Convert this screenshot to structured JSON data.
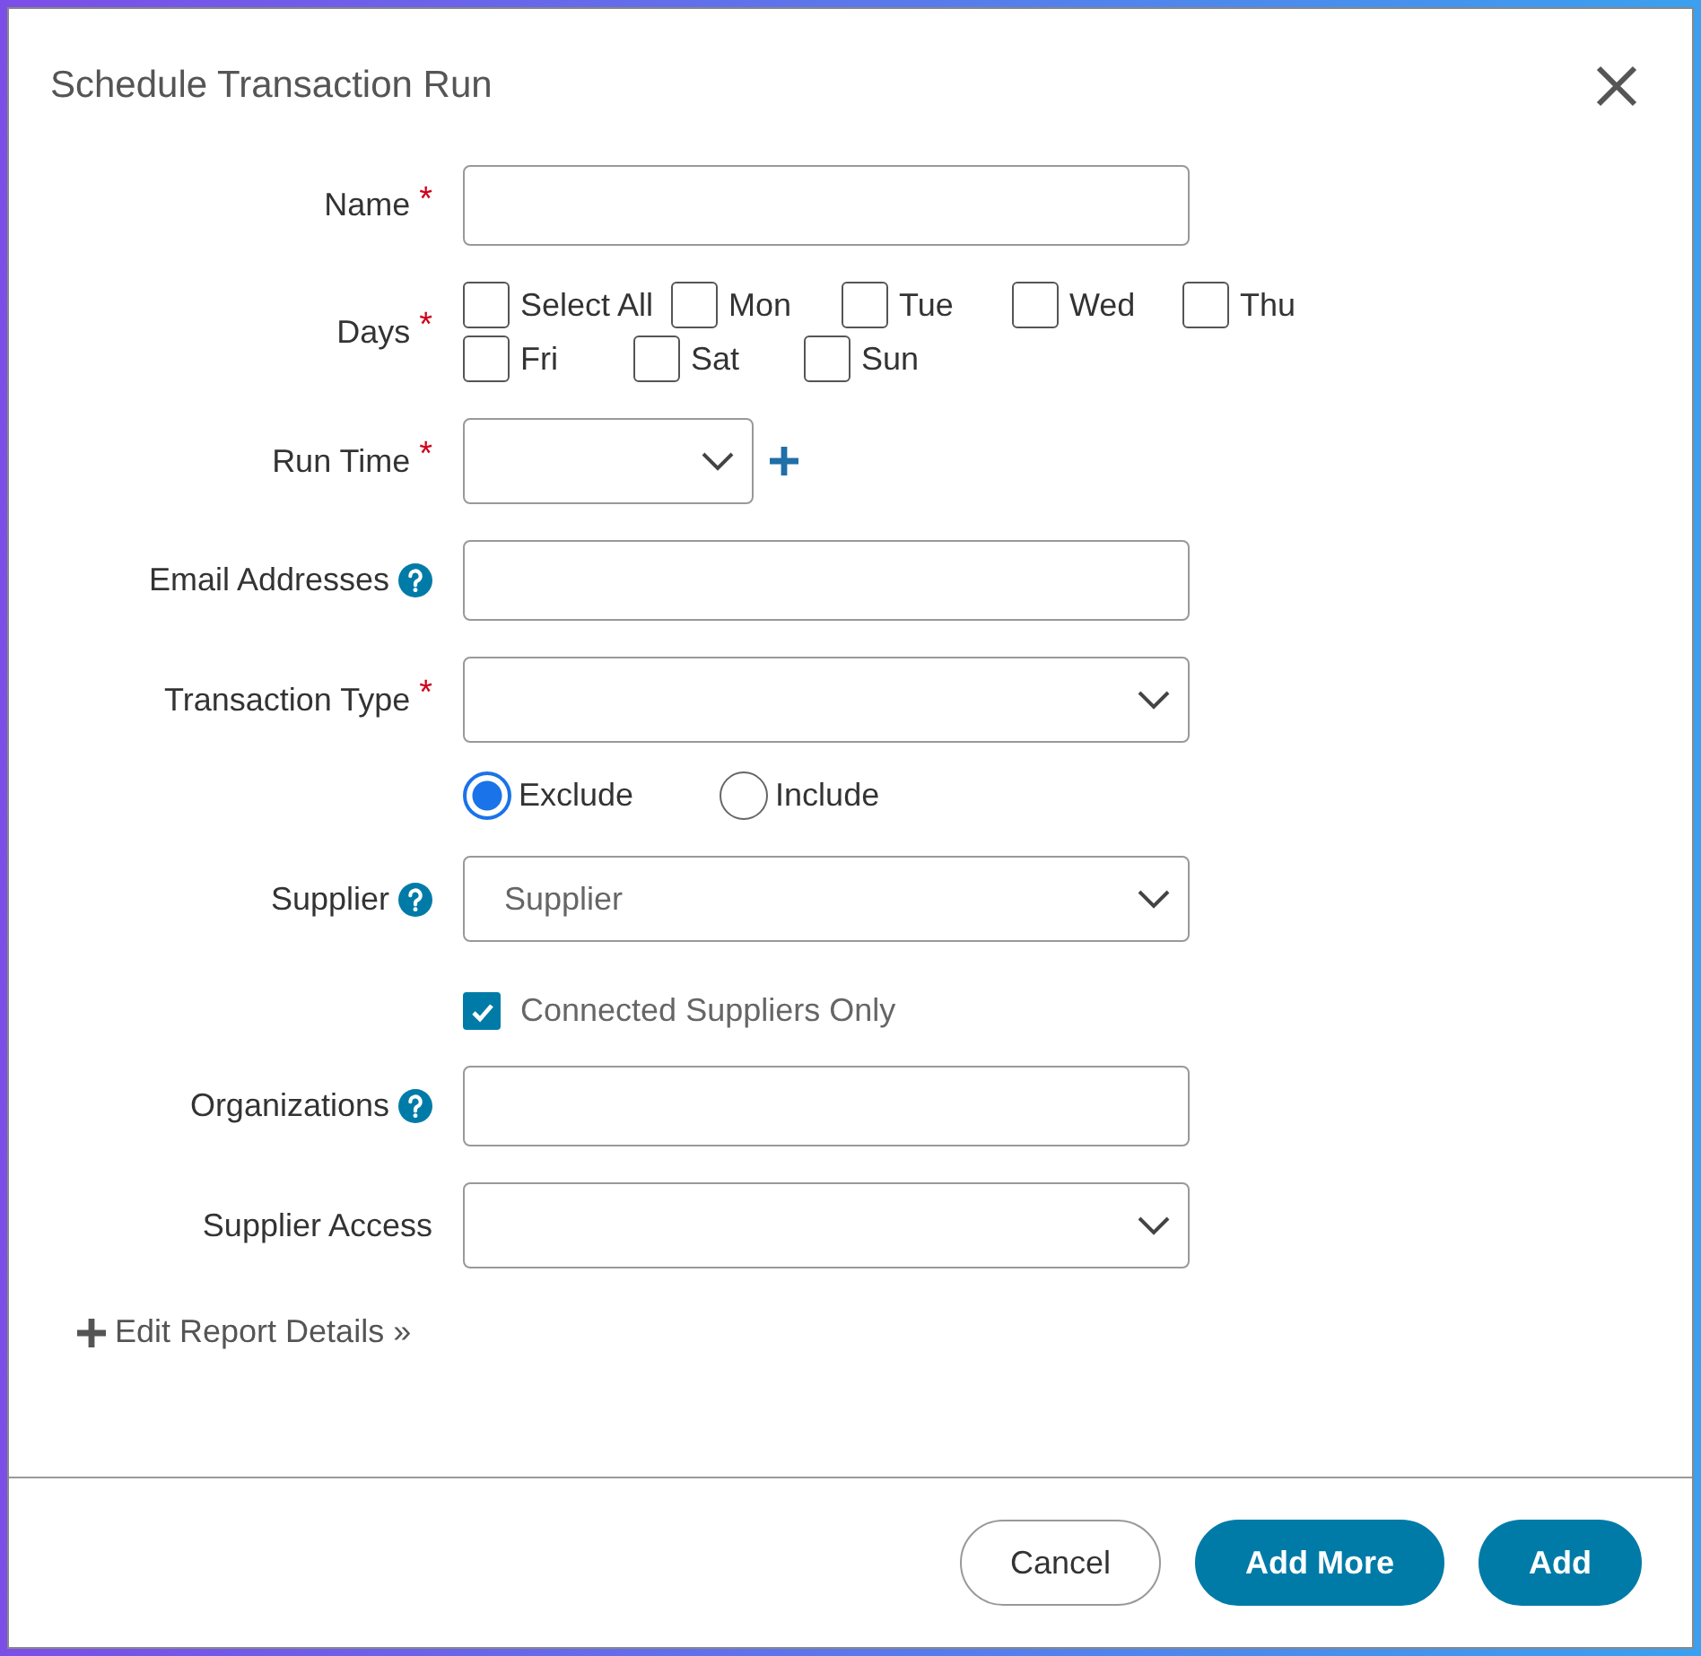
{
  "dialog": {
    "title": "Schedule Transaction Run"
  },
  "fields": [
    {
      "kind": "text",
      "label": "Name",
      "required_mark": "*"
    },
    {
      "kind": "days",
      "label": "Days",
      "required_mark": "*",
      "options": [
        {
          "label": "Select All",
          "checked": false
        },
        {
          "label": "Mon",
          "checked": false
        },
        {
          "label": "Tue",
          "checked": false
        },
        {
          "label": "Wed",
          "checked": false
        },
        {
          "label": "Thu",
          "checked": false
        },
        {
          "label": "Fri",
          "checked": false
        },
        {
          "label": "Sat",
          "checked": false
        },
        {
          "label": "Sun",
          "checked": false
        }
      ]
    },
    {
      "kind": "time",
      "label": "Run Time",
      "required_mark": "*"
    },
    {
      "kind": "text",
      "label": "Email Addresses",
      "help": true
    },
    {
      "kind": "select",
      "label": "Transaction Type",
      "required_mark": "*"
    },
    {
      "kind": "radios",
      "options": [
        {
          "label": "Exclude",
          "selected": true
        },
        {
          "label": "Include",
          "selected": false
        }
      ]
    },
    {
      "kind": "select",
      "label": "Supplier",
      "help": true,
      "placeholder": "Supplier"
    },
    {
      "kind": "checkbox",
      "label": "Connected Suppliers Only",
      "checked": true
    },
    {
      "kind": "text",
      "label": "Organizations",
      "help": true
    },
    {
      "kind": "select",
      "label": "Supplier Access"
    }
  ],
  "link": {
    "label": "Edit Report Details »"
  },
  "buttons": [
    {
      "label": "Cancel",
      "kind": "secondary"
    },
    {
      "label": "Add More",
      "kind": "primary"
    },
    {
      "label": "Add",
      "kind": "primary"
    }
  ]
}
